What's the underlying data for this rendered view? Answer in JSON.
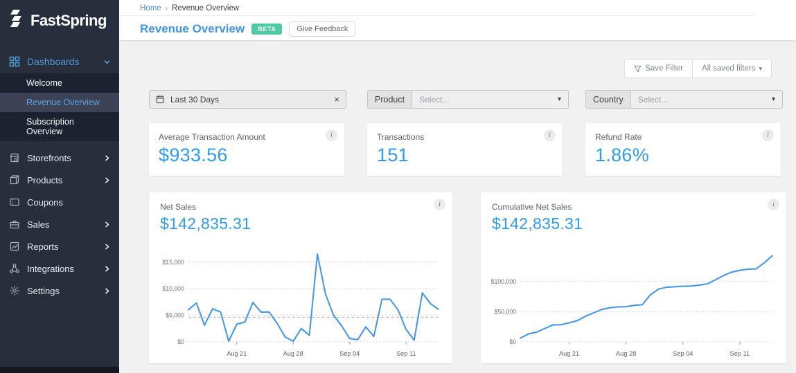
{
  "app": {
    "logo_text": "FastSpring"
  },
  "colors": {
    "sidebar_bg": "#272e3c",
    "accent_blue": "#4e9ad4",
    "value_blue": "#2f9bf2",
    "beta_teal": "#50c9a5",
    "line_blue": "#4696e8",
    "content_bg": "#f1f1f2"
  },
  "sidebar": {
    "dashboards": {
      "label": "Dashboards",
      "items": [
        {
          "label": "Welcome"
        },
        {
          "label": "Revenue Overview"
        },
        {
          "label": "Subscription Overview"
        }
      ]
    },
    "items": [
      {
        "label": "Storefronts"
      },
      {
        "label": "Products"
      },
      {
        "label": "Coupons"
      },
      {
        "label": "Sales"
      },
      {
        "label": "Reports"
      },
      {
        "label": "Integrations"
      },
      {
        "label": "Settings"
      }
    ]
  },
  "breadcrumb": {
    "home": "Home",
    "separator": "›",
    "current": "Revenue Overview"
  },
  "header": {
    "title": "Revenue Overview",
    "beta_badge": "BETA",
    "feedback_button": "Give Feedback"
  },
  "filter_bar": {
    "save_filter": "Save Filter",
    "all_saved_filters": "All saved filters",
    "caret": "▾",
    "date_filter": {
      "value": "Last 30 Days",
      "clear": "×"
    },
    "product_filter": {
      "label": "Product",
      "placeholder": "Select..."
    },
    "country_filter": {
      "label": "Country",
      "placeholder": "Select..."
    }
  },
  "metrics": [
    {
      "label": "Average Transaction Amount",
      "value": "$933.56",
      "info": "i"
    },
    {
      "label": "Transactions",
      "value": "151",
      "info": "i"
    },
    {
      "label": "Refund Rate",
      "value": "1.86%",
      "info": "i"
    }
  ],
  "chart_data": [
    {
      "type": "line",
      "title": "Net Sales",
      "display_value": "$142,835.31",
      "info": "i",
      "line_color": "#4696e8",
      "ylim": [
        0,
        17000
      ],
      "y_ticks": [
        0,
        5000,
        10000,
        15000
      ],
      "y_tick_labels": [
        "$0",
        "$5,000",
        "$10,000",
        "$15,000"
      ],
      "average_line": 4608,
      "x_tick_labels": [
        "Aug 21",
        "Aug 28",
        "Sep 04",
        "Sep 11"
      ],
      "x_tick_indices": [
        6,
        13,
        20,
        27
      ],
      "values": [
        6000,
        7300,
        3100,
        6200,
        5600,
        100,
        3300,
        3700,
        7400,
        5600,
        5600,
        3500,
        900,
        100,
        2500,
        1200,
        16500,
        9000,
        5000,
        3000,
        600,
        400,
        2800,
        1000,
        8000,
        8000,
        6000,
        2300,
        300,
        9200,
        7200,
        6100
      ]
    },
    {
      "type": "line",
      "title": "Cumulative Net Sales",
      "display_value": "$142,835.31",
      "info": "i",
      "line_color": "#4696e8",
      "ylim": [
        0,
        150000
      ],
      "y_ticks": [
        0,
        50000,
        100000
      ],
      "y_tick_labels": [
        "$0",
        "$50,000",
        "$100,000"
      ],
      "x_tick_labels": [
        "Aug 21",
        "Aug 28",
        "Sep 04",
        "Sep 11"
      ],
      "x_tick_indices": [
        6,
        13,
        20,
        27
      ],
      "values": [
        6000,
        13000,
        16000,
        22000,
        28000,
        28200,
        31500,
        35000,
        42500,
        48000,
        53500,
        56500,
        58000,
        58200,
        60500,
        61500,
        78000,
        87500,
        90500,
        91500,
        92000,
        92500,
        94000,
        96000,
        103000,
        110000,
        115500,
        118500,
        120500,
        121000,
        131000,
        142835.31
      ]
    }
  ]
}
